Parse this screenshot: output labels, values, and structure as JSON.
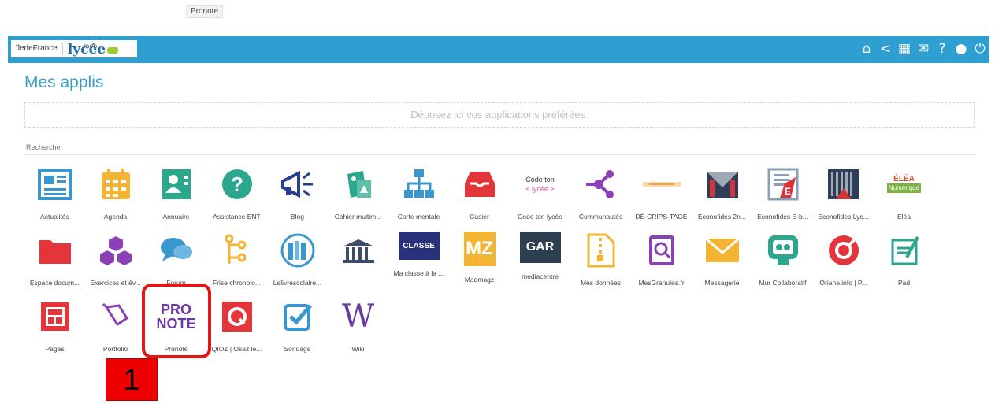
{
  "tooltip": "Pronote",
  "header": {
    "logo_region": "îledeFrance",
    "logo_brand_small": "mon",
    "logo_brand": "lycée",
    "icons": [
      "home-icon",
      "share-icon",
      "grid-icon",
      "mail-icon",
      "help-icon",
      "user-icon",
      "power-icon"
    ]
  },
  "page_title": "Mes applis",
  "dropzone_text": "Déposez ici vos applications préférées.",
  "search_label": "Rechercher",
  "apps_row1": [
    {
      "label": "Actualités"
    },
    {
      "label": "Agenda"
    },
    {
      "label": "Annuaire"
    },
    {
      "label": "Assistance ENT"
    },
    {
      "label": "Blog"
    },
    {
      "label": "Cahier multim..."
    },
    {
      "label": "Carte mentale"
    },
    {
      "label": "Casier"
    },
    {
      "label": "Code ton lycée",
      "icon_text_1": "Code ton",
      "icon_text_2": "< lycée >"
    },
    {
      "label": "Communautés"
    },
    {
      "label": "DÉ-CRIPS-TAGE"
    },
    {
      "label": "Econofides 2n..."
    },
    {
      "label": "Econofides E-b..."
    },
    {
      "label": "Econofides Lyc..."
    },
    {
      "label": "Eléa",
      "icon_text_1": "ÉLÉA",
      "icon_text_2": "Numérique"
    }
  ],
  "apps_row2": [
    {
      "label": "Espace docum..."
    },
    {
      "label": "Exercices et év..."
    },
    {
      "label": "Forum"
    },
    {
      "label": "Frise chronolo..."
    },
    {
      "label": "Lelivrescolaire..."
    },
    {
      "label": ""
    },
    {
      "label": "Ma classe à la ...",
      "icon_text_1": "CLASSE"
    },
    {
      "label": "Madmagz",
      "icon_text_1": "MZ"
    },
    {
      "label": "mediacentre",
      "icon_text_1": "GAR"
    },
    {
      "label": "Mes données"
    },
    {
      "label": "MesGranules.fr"
    },
    {
      "label": "Messagerie"
    },
    {
      "label": "Mur Collaboratif"
    },
    {
      "label": "Oriane.info | P..."
    },
    {
      "label": "Pad"
    }
  ],
  "apps_row3": [
    {
      "label": "Pages"
    },
    {
      "label": "Portfolio"
    },
    {
      "label": "Pronote",
      "icon_text_1": "PRO",
      "icon_text_2": "NOTE"
    },
    {
      "label": "QIOZ | Osez le..."
    },
    {
      "label": "Sondage"
    },
    {
      "label": "Wiki",
      "icon_text_1": "W"
    }
  ],
  "step_marker": "1",
  "colors": {
    "topbar": "#2e9fd0",
    "title": "#3aa0c8",
    "highlight": "#e41616"
  }
}
